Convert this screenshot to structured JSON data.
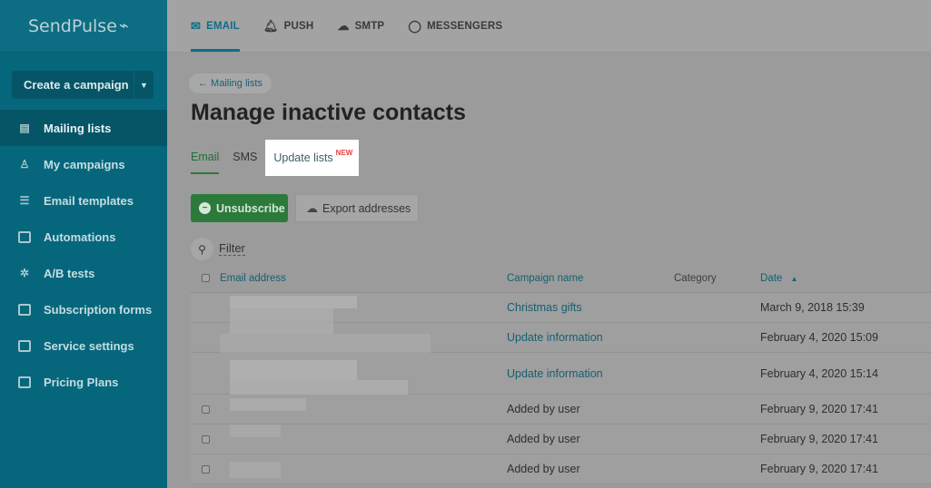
{
  "brand": {
    "name": "SendPulse",
    "pulse_glyph": "⁄⌇"
  },
  "sidebar": {
    "create_label": "Create a campaign",
    "items": [
      {
        "label": "Mailing lists",
        "icon": "list-icon",
        "active": true
      },
      {
        "label": "My campaigns",
        "icon": "campaign-icon",
        "active": false
      },
      {
        "label": "Email templates",
        "icon": "template-icon",
        "active": false
      },
      {
        "label": "Automations",
        "icon": "automation-icon",
        "active": false
      },
      {
        "label": "A/B tests",
        "icon": "ab-test-icon",
        "active": false
      },
      {
        "label": "Subscription forms",
        "icon": "form-icon",
        "active": false
      },
      {
        "label": "Service settings",
        "icon": "settings-icon",
        "active": false
      },
      {
        "label": "Pricing Plans",
        "icon": "pricing-icon",
        "active": false
      }
    ]
  },
  "topnav": {
    "tabs": [
      {
        "label": "EMAIL",
        "icon": "mail-icon",
        "active": true
      },
      {
        "label": "PUSH",
        "icon": "bell-icon",
        "active": false
      },
      {
        "label": "SMTP",
        "icon": "cloud-icon",
        "active": false
      },
      {
        "label": "MESSENGERS",
        "icon": "chat-icon",
        "active": false
      }
    ]
  },
  "page": {
    "breadcrumb": "← Mailing lists",
    "title": "Manage inactive contacts",
    "tabs": [
      {
        "label": "Email",
        "active": true
      },
      {
        "label": "SMS",
        "active": false
      },
      {
        "label": "Update lists",
        "badge": "NEW",
        "highlight": true
      }
    ],
    "unsubscribe_label": "Unsubscribe",
    "export_label": "Export addresses",
    "filter_label": "Filter"
  },
  "table": {
    "headers": {
      "email": "Email address",
      "campaign": "Campaign name",
      "category": "Category",
      "date": "Date"
    },
    "sort_indicator": "▲",
    "rows": [
      {
        "campaign": "Christmas gifts",
        "date": "March 9, 2018 15:39",
        "link": true,
        "checkbox": false
      },
      {
        "campaign": "Update information",
        "date": "February 4, 2020 15:09",
        "link": true,
        "checkbox": false
      },
      {
        "campaign": "Update information",
        "date": "February 4, 2020 15:14",
        "link": true,
        "checkbox": false
      },
      {
        "campaign": "Added by user",
        "date": "February 9, 2020 17:41",
        "link": false,
        "checkbox": true
      },
      {
        "campaign": "Added by user",
        "date": "February 9, 2020 17:41",
        "link": false,
        "checkbox": true
      },
      {
        "campaign": "Added by user",
        "date": "February 9, 2020 17:41",
        "link": false,
        "checkbox": true
      }
    ]
  }
}
